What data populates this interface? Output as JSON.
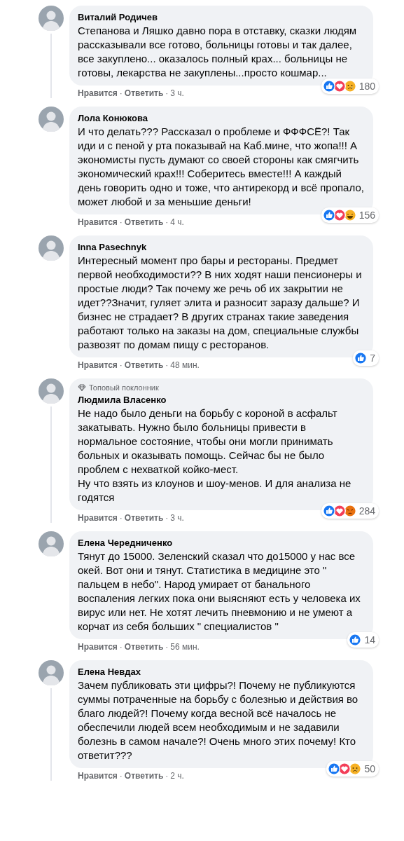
{
  "comments": [
    {
      "author": "Виталий Родичев",
      "text": "Степанова и Ляшко давно пора в отставку, сказки людям рассказывали все готово, больницы готовы и так далее, все закуплено... оказалось полный крах... больницы не готовы, лекарства не закуплены...просто кошмар...",
      "reactions": [
        {
          "kind": "like"
        },
        {
          "kind": "love"
        },
        {
          "kind": "sad"
        }
      ],
      "count": "180",
      "like": "Нравится",
      "separator": "·",
      "reply": "Ответить",
      "time": "3 ч.",
      "thread_line": true
    },
    {
      "author": "Лола Конюкова",
      "text": "И что делать??? Рассказал о проблеме и ФФФСЁ?! Так иди и с пеной у рта показывай на Каб.мине, что жопа!!! А экономисты пусть думают со своей стороны как смягчить экономический крах!!! Соберитесь вместе!!! А каждый день говорить одно и тоже, что антирекорд и всё пропало, может любой и за меньшие деньги!",
      "reactions": [
        {
          "kind": "like"
        },
        {
          "kind": "love"
        },
        {
          "kind": "haha"
        }
      ],
      "count": "156",
      "like": "Нравится",
      "separator": "·",
      "reply": "Ответить",
      "time": "4 ч.",
      "thread_line": false
    },
    {
      "author": "Inna Pasechnyk",
      "text": "Интересный момент про бары и рестораны. Предмет первой необходимости?? В них ходят наши пенсионеры и простые люди? Так почему же речь об их закрытии не идет??Значит, гуляет элита и разносит заразу дальше? И бизнес не страдает? В других странах такие заведения работают только на заказы на дом, специальные службы развозят по домам пищу с ресторанов.",
      "reactions": [
        {
          "kind": "like"
        }
      ],
      "count": "7",
      "like": "Нравится",
      "separator": "·",
      "reply": "Ответить",
      "time": "48 мин.",
      "thread_line": false
    },
    {
      "badge": "Топовый поклонник",
      "author": "Людмила Власенко",
      "text": "Не надо было деньги на борьбу с короной в асфальт закатывать. Нужно было больницы привести в нормальное состояние, чтобы они могли принимать больных и оказывать помощь. Сейчас бы не было проблем с нехваткой койко-мест.\nНу что взять из клоунов и шоу-менов. И для анализа не годятся",
      "reactions": [
        {
          "kind": "like"
        },
        {
          "kind": "love"
        },
        {
          "kind": "angry"
        }
      ],
      "count": "284",
      "like": "Нравится",
      "separator": "·",
      "reply": "Ответить",
      "time": "3 ч.",
      "thread_line": true
    },
    {
      "author": "Елена Чередниченко",
      "text": "Тянут до 15000. Зеленский сказал что до15000 у нас все окей. Вот они и тянут. Статистика в медицине это \" пальцем в небо\". Народ умирает от банального воспаления легких пока они выясняют есть у человека их вирус или нет. Не хотят лечить пневмонию и не умеют а корчат из себя больших \" специалистов \"",
      "reactions": [
        {
          "kind": "like"
        }
      ],
      "count": "14",
      "like": "Нравится",
      "separator": "·",
      "reply": "Ответить",
      "time": "56 мин.",
      "thread_line": false
    },
    {
      "author": "Елена Невдах",
      "text": "Зачем публиковать эти цифры?! Почему не публикуются суммы потраченные на борьбу с болезнью и действия во благо людей?! Почему когда весной всё началось не обеспечили людей всем необходимым и не задавили болезнь в самом начале?! Очень много этих почему! Кто ответит???",
      "reactions": [
        {
          "kind": "like"
        },
        {
          "kind": "love"
        },
        {
          "kind": "sad"
        }
      ],
      "count": "50",
      "like": "Нравится",
      "separator": "·",
      "reply": "Ответить",
      "time": "2 ч.",
      "thread_line": true
    }
  ]
}
